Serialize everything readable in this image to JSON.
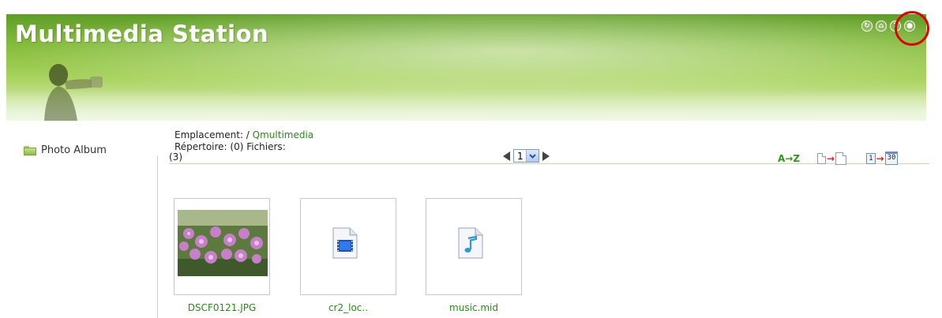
{
  "header": {
    "title": "Multimedia Station",
    "icons": [
      "refresh-icon",
      "home-icon",
      "help-icon",
      "logout-icon"
    ]
  },
  "sidebar": {
    "items": [
      {
        "label": "Photo Album",
        "icon": "folder-icon"
      }
    ]
  },
  "location": {
    "prefix": "Emplacement: /",
    "path": "Qmultimedia",
    "directory_info": "Répertoire: (0) Fichiers:",
    "file_count": "(3)"
  },
  "pager": {
    "current_page": "1"
  },
  "toolbar": {
    "sort_label": "A→Z",
    "per_page_from": "1",
    "per_page_to": "30"
  },
  "files": [
    {
      "name": "DSCF0121.JPG",
      "type": "image"
    },
    {
      "name": "cr2_loc..",
      "type": "video"
    },
    {
      "name": "music.mid",
      "type": "audio"
    }
  ],
  "colors": {
    "accent": "#2a8a18",
    "banner_dark": "#5f9d28",
    "banner_light": "#cfe6a4",
    "highlight": "#e00000"
  }
}
